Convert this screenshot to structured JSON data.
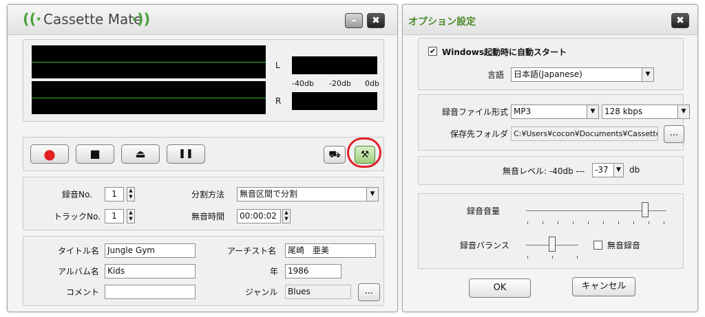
{
  "main": {
    "title": "Cassette Mate",
    "title_icon_left": "((·",
    "title_icon_right": "·))",
    "minimize": "–",
    "close": "✖",
    "meter": {
      "L": "L",
      "R": "R",
      "scale": [
        "-40db",
        "-20db",
        "0db"
      ]
    },
    "transport": {
      "record": "●",
      "stop": "■",
      "eject": "⏏",
      "pause": "❚❚"
    },
    "tools": {
      "cart": "⛟",
      "settings": "⚒"
    },
    "recording": {
      "rec_no_label": "録音No.",
      "rec_no_value": "1",
      "track_no_label": "トラックNo.",
      "track_no_value": "1",
      "split_label": "分割方法",
      "split_value": "無音区間で分割",
      "silence_label": "無音時間",
      "silence_value": "00:00:02"
    },
    "tags": {
      "title_label": "タイトル名",
      "title_value": "Jungle Gym",
      "artist_label": "アーチスト名",
      "artist_value": "尾崎　亜美",
      "album_label": "アルバム名",
      "album_value": "Kids",
      "year_label": "年",
      "year_value": "1986",
      "comment_label": "コメント",
      "comment_value": "",
      "genre_label": "ジャンル",
      "genre_value": "Blues",
      "browse": "..."
    }
  },
  "options": {
    "title": "オプション設定",
    "close": "✖",
    "autostart_label": "Windows起動時に自動スタート",
    "autostart_checked": "✔",
    "language_label": "言語",
    "language_value": "日本語(Japanese)",
    "format_label": "録音ファイル形式",
    "format_value": "MP3",
    "bitrate_value": "128 kbps",
    "folder_label": "保存先フォルダ",
    "folder_value": "C:¥Users¥cocon¥Documents¥Cassette",
    "folder_browse": "...",
    "silence_level_label": "無音レベル: -40db ---",
    "silence_level_value": "-37",
    "silence_level_unit": "db",
    "volume_label": "録音音量",
    "volume_level": 0.85,
    "balance_label": "録音バランス",
    "balance_level": 0.5,
    "mute_label": "無音録音",
    "ok": "OK",
    "cancel": "キャンセル"
  },
  "colors": {
    "accent_green": "#4aa33a",
    "highlight_red": "#e0202a"
  }
}
